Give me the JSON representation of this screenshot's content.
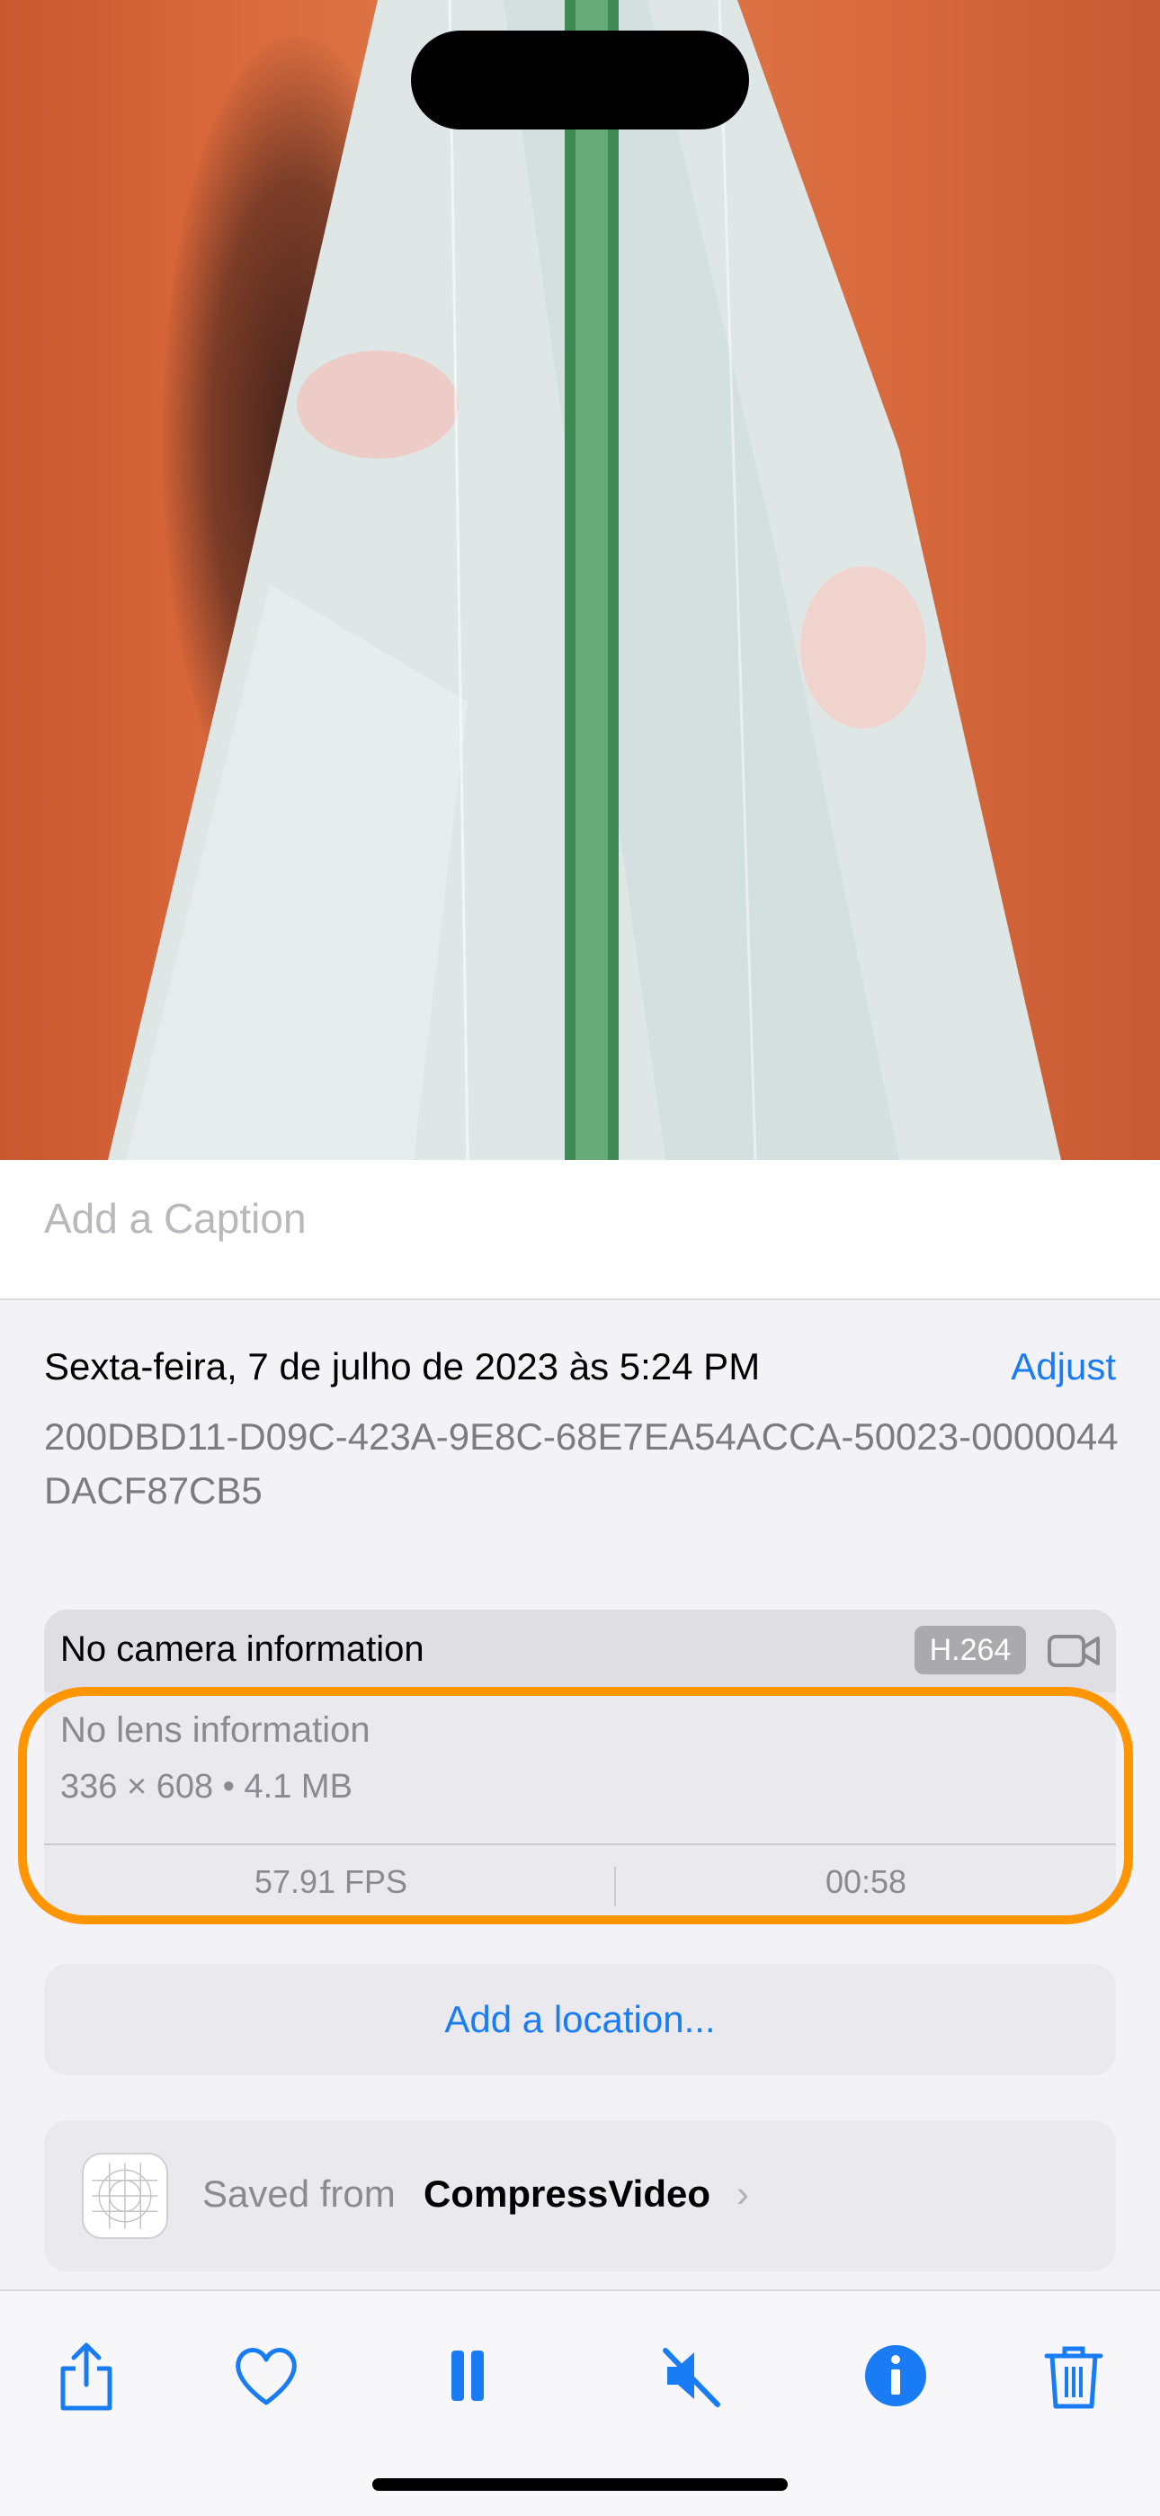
{
  "caption": {
    "placeholder": "Add a Caption"
  },
  "info": {
    "date": "Sexta-feira, 7 de julho de 2023 às 5:24 PM",
    "adjust_label": "Adjust",
    "filename": "200DBD11-D09C-423A-9E8C-68E7EA54ACCA-50023-0000044DACF87CB5"
  },
  "camera_card": {
    "title": "No camera information",
    "codec_badge": "H.264",
    "lens": "No lens information",
    "dimensions": "336 × 608  •  4.1 MB",
    "fps": "57.91 FPS",
    "duration": "00:58"
  },
  "location": {
    "label": "Add a location..."
  },
  "saved_from": {
    "prefix": "Saved from",
    "app": "CompressVideo",
    "chevron": "›"
  },
  "toolbar": {
    "icons": [
      "share-icon",
      "heart-icon",
      "pause-icon",
      "mute-icon",
      "info-icon",
      "trash-icon"
    ],
    "accent": "#1a7cf5"
  },
  "colors": {
    "highlight": "#ff9500",
    "link": "#1a7cf5"
  }
}
